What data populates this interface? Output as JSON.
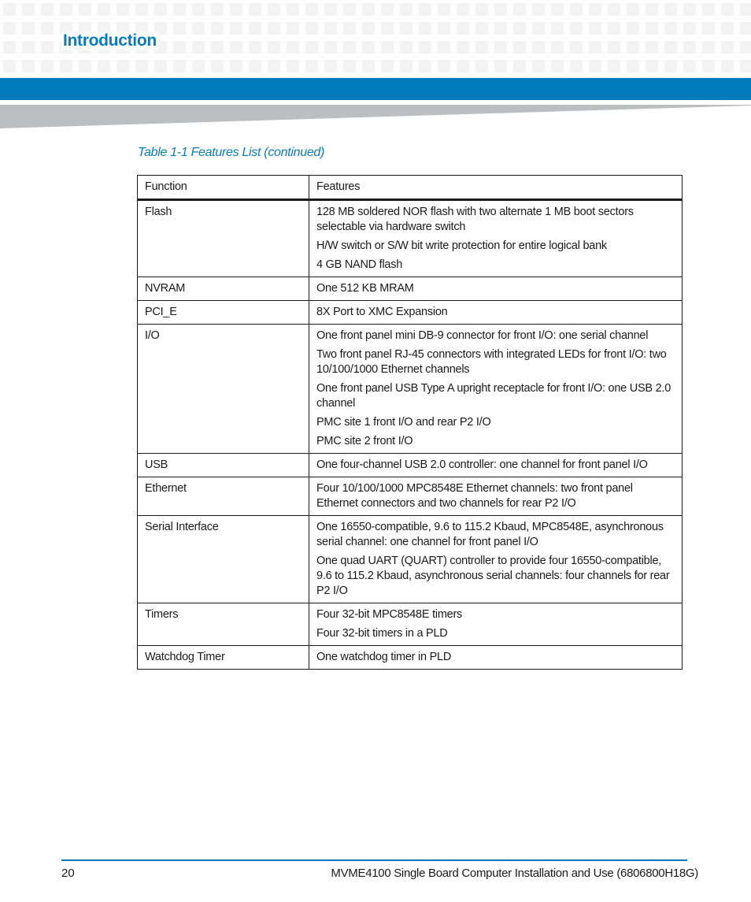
{
  "header": {
    "section_title": "Introduction",
    "colors": {
      "brand_blue": "#007cbd",
      "title_blue": "#0a7bb8",
      "wedge_gray": "#bdbec0",
      "pattern_gray": "#f3f3f3"
    }
  },
  "table": {
    "caption": "Table 1-1 Features List (continued)",
    "columns": [
      "Function",
      "Features"
    ],
    "rows": [
      {
        "function": "Flash",
        "features": [
          "128 MB soldered NOR flash with two alternate 1 MB boot sectors selectable via hardware switch",
          "H/W switch or S/W bit write protection for entire logical bank",
          "4 GB NAND flash"
        ]
      },
      {
        "function": "NVRAM",
        "features": [
          "One 512 KB MRAM"
        ]
      },
      {
        "function": "PCI_E",
        "features": [
          "8X Port to XMC Expansion"
        ]
      },
      {
        "function": "I/O",
        "features": [
          "One front panel mini DB-9 connector for front I/O: one serial channel",
          "Two front panel RJ-45 connectors with integrated LEDs for front I/O: two 10/100/1000 Ethernet channels",
          "One front panel USB Type A upright receptacle for front I/O: one USB 2.0 channel",
          "PMC site 1 front I/O and rear P2 I/O",
          "PMC site 2 front I/O"
        ]
      },
      {
        "function": "USB",
        "features": [
          "One four-channel USB 2.0 controller: one channel for front panel I/O"
        ]
      },
      {
        "function": "Ethernet",
        "features": [
          "Four 10/100/1000 MPC8548E Ethernet channels: two front panel Ethernet connectors and two channels for rear P2 I/O"
        ]
      },
      {
        "function": "Serial Interface",
        "features": [
          "One 16550-compatible, 9.6 to 115.2 Kbaud, MPC8548E, asynchronous serial channel: one channel for front panel I/O",
          "One quad UART (QUART) controller to provide four 16550-compatible, 9.6 to 115.2 Kbaud, asynchronous serial channels: four channels for rear P2 I/O"
        ]
      },
      {
        "function": "Timers",
        "features": [
          "Four 32-bit MPC8548E timers",
          "Four 32-bit timers in a PLD"
        ]
      },
      {
        "function": "Watchdog Timer",
        "features": [
          "One watchdog timer in PLD"
        ]
      }
    ]
  },
  "footer": {
    "page_number": "20",
    "document_title": "MVME4100 Single Board Computer Installation and Use (6806800H18G)"
  }
}
